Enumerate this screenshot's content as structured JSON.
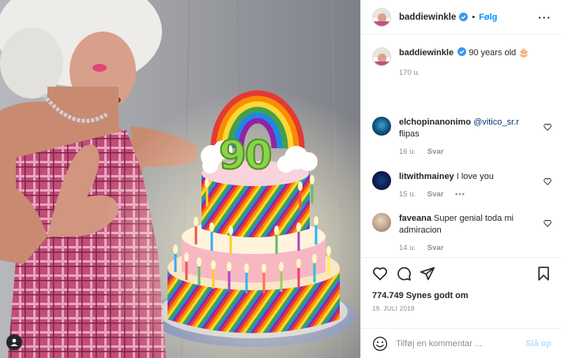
{
  "post": {
    "author": {
      "username": "baddiewinkle",
      "verified_icon": "verified-badge-icon",
      "follow_label": "Følg",
      "separator": "•"
    },
    "caption": {
      "username": "baddiewinkle",
      "text": "90 years old 🎂",
      "time": "170 u."
    },
    "photo": {
      "cake_number": "90",
      "tag_icon": "user-tag-icon"
    },
    "comments": [
      {
        "username": "elchopinanonimo",
        "mention": "@vitico_sr.r",
        "text": "flipas",
        "time": "16 u.",
        "reply_label": "Svar"
      },
      {
        "username": "litwithmainey",
        "text": "I love you",
        "time": "15 u.",
        "reply_label": "Svar",
        "more": "•••"
      },
      {
        "username": "faveana",
        "text": "Super genial toda mi admiracion",
        "time": "14 u.",
        "reply_label": "Svar"
      }
    ],
    "likes": "774.749 Synes godt om",
    "date": "19. JULI 2018",
    "add_comment": {
      "placeholder": "Tilføj en kommentar ...",
      "post_label": "Slå op"
    },
    "icons": [
      "more-options-icon",
      "heart-icon",
      "comment-icon",
      "share-icon",
      "bookmark-icon",
      "emoji-icon"
    ],
    "colors": {
      "accent": "#0095f6",
      "post_disabled": "#b2dffc",
      "muted": "#8e8e8e",
      "text": "#262626"
    }
  }
}
